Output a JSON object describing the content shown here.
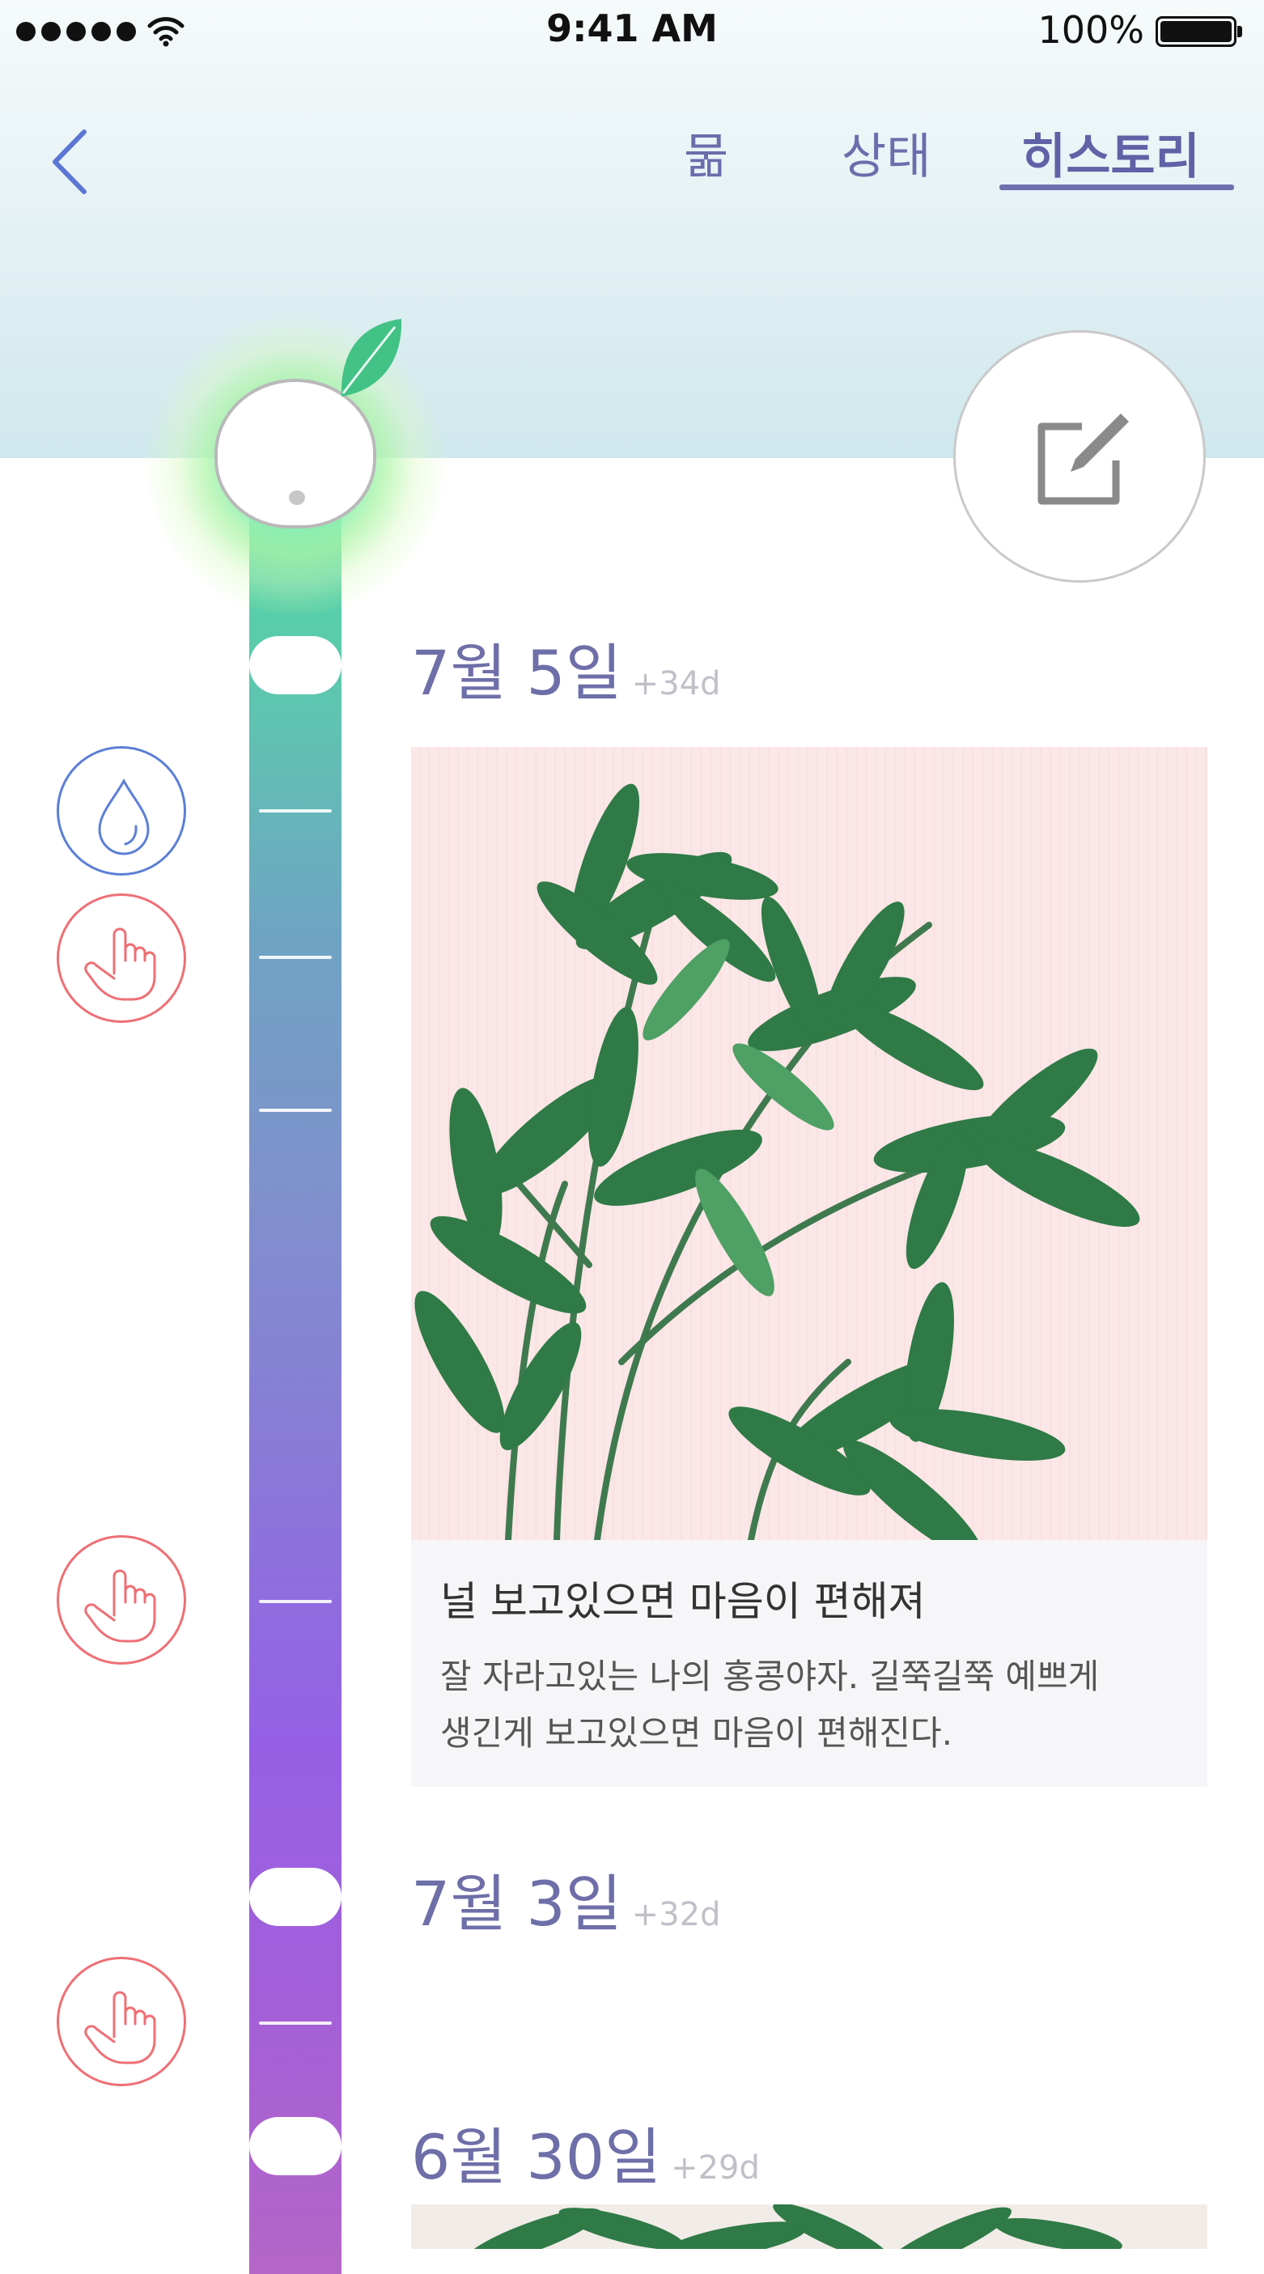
{
  "status_bar": {
    "time": "9:41 AM",
    "battery": "100%",
    "signal_icon": "signal-dots-icon",
    "wifi_icon": "wifi-icon"
  },
  "nav": {
    "back_icon": "chevron-left-icon",
    "tabs": [
      {
        "label": "묾"
      },
      {
        "label": "상태"
      },
      {
        "label": "히스토리",
        "active": true
      }
    ]
  },
  "edit_icon": "edit-note-icon",
  "timeline": {
    "colors": {
      "track_top": "#4fd8a0",
      "track_bottom": "#b466c7",
      "water": "#5b7fd6",
      "touch": "#ef6f74",
      "date": "#6e6ea8"
    },
    "entries": [
      {
        "date": "7월 5일",
        "days": "+34d",
        "photo_icon": "plant-photo",
        "title": "널 보고있으면 마음이 편해져",
        "body_line1": "잘 자라고있는 나의 홍콩야자. 길쭉길쭉 예쁘게",
        "body_line2": "생긴게 보고있으면 마음이 편해진다."
      },
      {
        "date": "7월 3일",
        "days": "+32d"
      },
      {
        "date": "6월 30일",
        "days": "+29d",
        "photo_icon": "plant-photo"
      }
    ],
    "activities": [
      {
        "icon": "water-drop-icon"
      },
      {
        "icon": "touch-hand-icon"
      },
      {
        "icon": "touch-hand-icon"
      },
      {
        "icon": "touch-hand-icon"
      }
    ]
  }
}
